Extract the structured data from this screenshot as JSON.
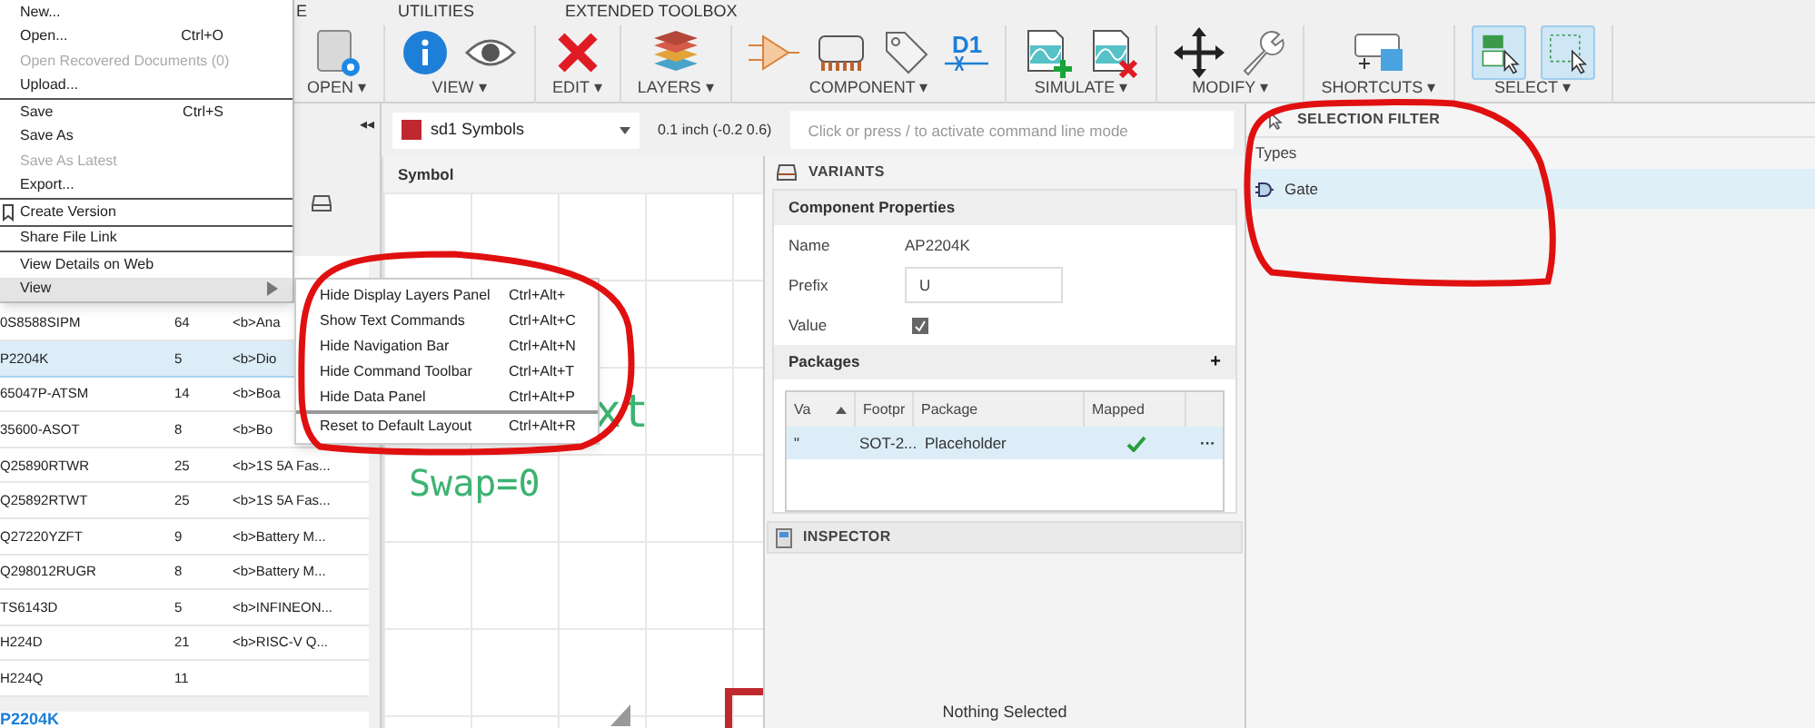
{
  "ribbon": {
    "tabs": [
      {
        "label": "E"
      },
      {
        "label": "UTILITIES"
      },
      {
        "label": "EXTENDED TOOLBOX"
      }
    ],
    "groups": [
      {
        "label": "OPEN",
        "arrow": "▾",
        "tools": [
          {
            "kind": "open",
            "selected": false
          }
        ]
      },
      {
        "label": "VIEW",
        "arrow": "▾",
        "tools": [
          {
            "kind": "info",
            "selected": false
          },
          {
            "kind": "eye",
            "selected": false
          }
        ]
      },
      {
        "label": "EDIT",
        "arrow": "▾",
        "tools": [
          {
            "kind": "delete",
            "selected": false
          }
        ]
      },
      {
        "label": "LAYERS",
        "arrow": "▾",
        "tools": [
          {
            "kind": "layers",
            "selected": false
          }
        ]
      },
      {
        "label": "COMPONENT",
        "arrow": "▾",
        "tools": [
          {
            "kind": "pin",
            "selected": false
          },
          {
            "kind": "chip",
            "selected": false
          },
          {
            "kind": "tag",
            "selected": false
          },
          {
            "kind": "designator",
            "text": "D1",
            "selected": false
          }
        ]
      },
      {
        "label": "SIMULATE",
        "arrow": "▾",
        "tools": [
          {
            "kind": "sim-add",
            "selected": false
          },
          {
            "kind": "sim-remove",
            "selected": false
          }
        ]
      },
      {
        "label": "MODIFY",
        "arrow": "▾",
        "tools": [
          {
            "kind": "move",
            "selected": false
          },
          {
            "kind": "wrench",
            "selected": false
          }
        ]
      },
      {
        "label": "SHORTCUTS",
        "arrow": "▾",
        "tools": [
          {
            "kind": "shortcut",
            "selected": false
          }
        ]
      },
      {
        "label": "SELECT",
        "arrow": "▾",
        "tools": [
          {
            "kind": "select-group",
            "selected": true
          },
          {
            "kind": "select-window",
            "selected": true
          }
        ]
      }
    ]
  },
  "command_bar": {
    "layer": {
      "name": "sd1 Symbols",
      "color": "#c0282f"
    },
    "grid": "0.1 inch (-0.2 0.6)",
    "command": {
      "placeholder": "Click or press / to activate command line mode"
    }
  },
  "library": {
    "collapse": "◂◂",
    "rows": [
      {
        "name": "0S8588SIPM",
        "pins": "64",
        "description": "<b>Ana",
        "selected": false
      },
      {
        "name": "P2204K",
        "pins": "5",
        "description": "<b>Dio",
        "selected": true
      },
      {
        "name": "65047P-ATSM",
        "pins": "14",
        "description": "<b>Boa",
        "selected": false
      },
      {
        "name": "35600-ASOT",
        "pins": "8",
        "description": "<b>Bo",
        "selected": false
      },
      {
        "name": "Q25890RTWR",
        "pins": "25",
        "description": "<b>1S 5A Fas...",
        "selected": false
      },
      {
        "name": "Q25892RTWT",
        "pins": "25",
        "description": "<b>1S 5A Fas...",
        "selected": false
      },
      {
        "name": "Q27220YZFT",
        "pins": "9",
        "description": "<b>Battery M...",
        "selected": false
      },
      {
        "name": "Q298012RUGR",
        "pins": "8",
        "description": "<b>Battery M...",
        "selected": false
      },
      {
        "name": "TS6143D",
        "pins": "5",
        "description": "<b>INFINEON...",
        "selected": false
      },
      {
        "name": "H224D",
        "pins": "21",
        "description": "<b>RISC-V Q...",
        "selected": false
      },
      {
        "name": "H224Q",
        "pins": "11",
        "selected": false
      }
    ],
    "detail_title": "P2204K"
  },
  "canvas": {
    "title": "Symbol",
    "texts": [
      "xt",
      "Swap=0"
    ]
  },
  "variants": {
    "title": "VARIANTS",
    "properties_title": "Component Properties",
    "name": {
      "label": "Name",
      "value": "AP2204K"
    },
    "prefix": {
      "label": "Prefix",
      "value": "U"
    },
    "value": {
      "label": "Value",
      "checked": true
    },
    "packages": {
      "title": "Packages",
      "add": "+",
      "columns": [
        "Va",
        "Footpr",
        "Package",
        "Mapped"
      ],
      "rows": [
        {
          "variant": "\"",
          "footprint": "SOT-2...",
          "package": "Placeholder",
          "mapped": true,
          "more": "···",
          "selected": true
        }
      ]
    }
  },
  "inspector": {
    "title": "INSPECTOR",
    "empty": "Nothing Selected"
  },
  "selection_filter": {
    "title": "SELECTION FILTER",
    "section": "Types",
    "items": [
      {
        "label": "Gate",
        "selected": true
      }
    ]
  },
  "file_menu": {
    "groups": [
      {
        "items": [
          {
            "label": "New...",
            "disabled": false,
            "selected": false,
            "submenu": false
          },
          {
            "label": "Open...",
            "shortcut": "Ctrl+O",
            "disabled": false,
            "selected": false,
            "submenu": false
          },
          {
            "label": "Open Recovered Documents (0)",
            "disabled": true,
            "selected": false,
            "submenu": false
          },
          {
            "label": "Upload...",
            "disabled": false,
            "selected": false,
            "submenu": false
          }
        ]
      },
      {
        "items": [
          {
            "label": "Save",
            "shortcut": "Ctrl+S",
            "disabled": false,
            "selected": false,
            "submenu": false
          },
          {
            "label": "Save As",
            "disabled": false,
            "selected": false,
            "submenu": false
          },
          {
            "label": "Save As Latest",
            "disabled": true,
            "selected": false,
            "submenu": false
          },
          {
            "label": "Export...",
            "disabled": false,
            "selected": false,
            "submenu": false
          }
        ]
      },
      {
        "items": [
          {
            "label": "Create Version",
            "kind": "bookmark",
            "disabled": false,
            "selected": false,
            "submenu": false
          }
        ]
      },
      {
        "items": [
          {
            "label": "Share File Link",
            "disabled": false,
            "selected": false,
            "submenu": false
          }
        ]
      },
      {
        "items": [
          {
            "label": "View Details on Web",
            "disabled": false,
            "selected": false,
            "submenu": false
          },
          {
            "label": "View",
            "disabled": false,
            "selected": true,
            "submenu": true
          }
        ]
      }
    ]
  },
  "view_submenu": {
    "groups": [
      {
        "items": [
          {
            "label": "Hide Display Layers Panel",
            "shortcut": "Ctrl+Alt+"
          },
          {
            "label": "Show Text Commands",
            "shortcut": "Ctrl+Alt+C"
          },
          {
            "label": "Hide Navigation Bar",
            "shortcut": "Ctrl+Alt+N"
          },
          {
            "label": "Hide Command Toolbar",
            "shortcut": "Ctrl+Alt+T"
          },
          {
            "label": "Hide Data Panel",
            "shortcut": "Ctrl+Alt+P"
          }
        ]
      },
      {
        "items": [
          {
            "label": "Reset to Default Layout",
            "shortcut": "Ctrl+Alt+R"
          }
        ]
      }
    ]
  }
}
